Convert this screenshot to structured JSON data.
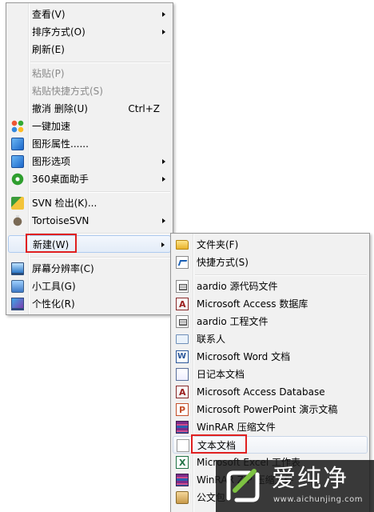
{
  "main_menu": {
    "items": [
      {
        "label": "查看(V)"
      },
      {
        "label": "排序方式(O)"
      },
      {
        "label": "刷新(E)"
      },
      {
        "label": "粘贴(P)"
      },
      {
        "label": "粘贴快捷方式(S)"
      },
      {
        "label": "撤消 删除(U)",
        "shortcut": "Ctrl+Z"
      },
      {
        "label": "一键加速",
        "icon": "colored-circles-icon"
      },
      {
        "label": "图形属性......",
        "icon": "graphics-icon"
      },
      {
        "label": "图形选项",
        "icon": "graphics-icon"
      },
      {
        "label": "360桌面助手",
        "icon": "360-icon"
      },
      {
        "label": "SVN 检出(K)...",
        "icon": "svn-icon"
      },
      {
        "label": "TortoiseSVN",
        "icon": "tortoise-icon"
      },
      {
        "label": "新建(W)"
      },
      {
        "label": "屏幕分辨率(C)",
        "icon": "screen-icon"
      },
      {
        "label": "小工具(G)",
        "icon": "gadget-icon"
      },
      {
        "label": "个性化(R)",
        "icon": "personalize-icon"
      }
    ]
  },
  "sub_menu": {
    "items": [
      {
        "label": "文件夹(F)",
        "icon": "folder-icon"
      },
      {
        "label": "快捷方式(S)",
        "icon": "shortcut-icon"
      },
      {
        "label": "aardio 源代码文件",
        "icon": "document-icon"
      },
      {
        "label": "Microsoft Access 数据库",
        "icon": "access-icon"
      },
      {
        "label": "aardio 工程文件",
        "icon": "document-icon"
      },
      {
        "label": "联系人",
        "icon": "contact-icon"
      },
      {
        "label": "Microsoft Word 文档",
        "icon": "word-icon"
      },
      {
        "label": "日记本文档",
        "icon": "journal-icon"
      },
      {
        "label": "Microsoft Access Database",
        "icon": "access-icon"
      },
      {
        "label": "Microsoft PowerPoint 演示文稿",
        "icon": "powerpoint-icon"
      },
      {
        "label": "WinRAR 压缩文件",
        "icon": "winrar-icon"
      },
      {
        "label": "文本文档",
        "icon": "text-file-icon"
      },
      {
        "label": "Microsoft Excel 工作表",
        "icon": "excel-icon"
      },
      {
        "label": "WinRAR ZIP 压缩文件",
        "icon": "winrar-icon"
      },
      {
        "label": "公文包",
        "icon": "briefcase-icon"
      }
    ]
  },
  "watermark": {
    "title": "爱纯净",
    "url": "www.aichunjing.com"
  },
  "colors": {
    "highlight_box": "#e02020",
    "menu_bg": "#f1f1f1",
    "menu_border": "#979797"
  }
}
